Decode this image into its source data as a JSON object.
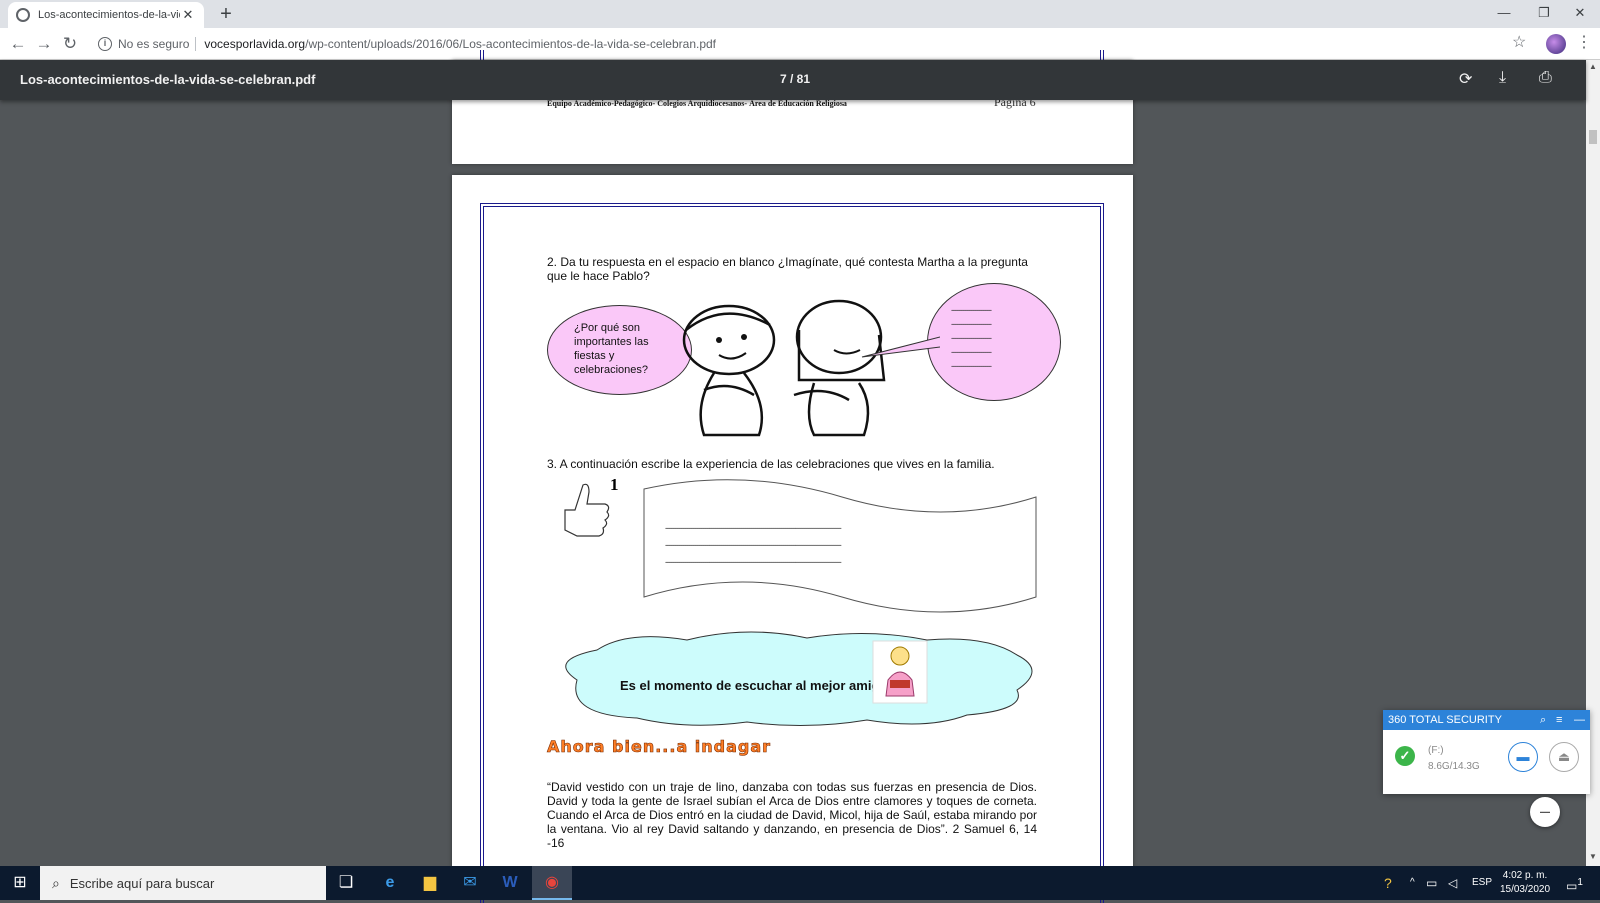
{
  "browser": {
    "tab_title": "Los-acontecimientos-de-la-vida-",
    "tab_close": "✕",
    "new_tab": "+",
    "insecure_label": "No es seguro",
    "url_host": "vocesporlavida.org",
    "url_path": "/wp-content/uploads/2016/06/Los-acontecimientos-de-la-vida-se-celebran.pdf"
  },
  "pdf_viewer": {
    "filename": "Los-acontecimientos-de-la-vida-se-celebran.pdf",
    "page_indicator": "7 / 81"
  },
  "prev_page": {
    "footer": "Equipo Académico-Pedagógico- Colegios Arquidiocesanos- Área de Educación Religiosa",
    "page_label": "Página 6"
  },
  "page": {
    "q2": "2. Da tu respuesta en el espacio en blanco ¿Imagínate, qué contesta Martha a la pregunta que le hace Pablo?",
    "bubble_left": "¿Por qué son importantes las fiestas y celebraciones?",
    "bubble_right_lines": [
      "--------------------",
      "--------------------",
      "--------------------",
      "--------------------",
      "--------------------"
    ],
    "q3": "3. A continuación escribe la experiencia de las celebraciones que vives en la familia.",
    "thumb_number": "1",
    "banner_lines": [
      "----------------------------------------------------------------------------------------",
      "----------------------------------------------------------------------------------------",
      "----------------------------------------------------------------------------------------"
    ],
    "cloud_text": "Es el momento de escuchar al mejor amigo",
    "heading": "Ahora bien...a indagar",
    "quote": "“David vestido  con un traje de lino, danzaba con todas sus fuerzas en presencia de Dios. David y toda la gente de Israel subían el Arca de Dios entre clamores y toques de corneta. Cuando el Arca de Dios entró en la ciudad de David, Micol, hija de Saúl, estaba mirando por la ventana. Vio al rey David saltando y danzando, en presencia de Dios”. 2 Samuel 6, 14 -16"
  },
  "security_widget": {
    "title": "360 TOTAL SECURITY",
    "drive_label": "(F:)",
    "drive_usage": "8.6G/14.3G"
  },
  "taskbar": {
    "search_placeholder": "Escribe aquí para buscar",
    "language": "ESP",
    "time": "4:02 p. m.",
    "date": "15/03/2020",
    "notification_count": "1"
  },
  "colors": {
    "pdf_toolbar": "#323639",
    "frame_blue": "#1a1a8c",
    "bubble_pink": "#fac8f8",
    "cloud_cyan": "#cdfcfc",
    "heading_orange": "#ff7f27",
    "security_blue": "#2d83d9"
  }
}
